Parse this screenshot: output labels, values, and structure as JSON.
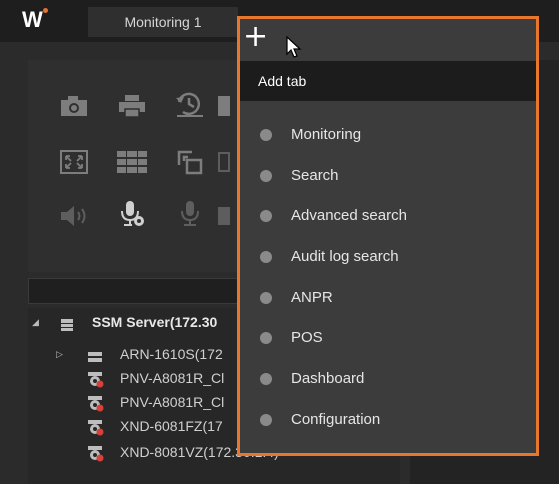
{
  "header": {
    "logo_text": "W",
    "tab_label": "Monitoring 1",
    "add_symbol": "+"
  },
  "tree": {
    "items": [
      {
        "label": "SSM Server(172.30"
      },
      {
        "label": "ARN-1610S(172"
      },
      {
        "label": "PNV-A8081R_Cl"
      },
      {
        "label": "PNV-A8081R_Cl"
      },
      {
        "label": "XND-6081FZ(17"
      },
      {
        "label": "XND-8081VZ(172.30.1.4)"
      }
    ]
  },
  "menu": {
    "title": "Add tab",
    "items": [
      {
        "label": "Monitoring"
      },
      {
        "label": "Search"
      },
      {
        "label": "Advanced search"
      },
      {
        "label": "Audit log search"
      },
      {
        "label": "ANPR"
      },
      {
        "label": "POS"
      },
      {
        "label": "Dashboard"
      },
      {
        "label": "Configuration"
      }
    ]
  },
  "colors": {
    "accent": "#e8772e",
    "camera_dot": "#d8413a"
  },
  "icons": [
    "camera-icon",
    "printer-icon",
    "refresh-clock-icon",
    "layout-icon",
    "fullscreen-icon",
    "grid-icon",
    "copy-window-icon",
    "speaker-icon",
    "mic-settings-icon",
    "mic-icon",
    "server-icon",
    "recorder-icon",
    "camera-device-icon",
    "cursor-icon"
  ]
}
